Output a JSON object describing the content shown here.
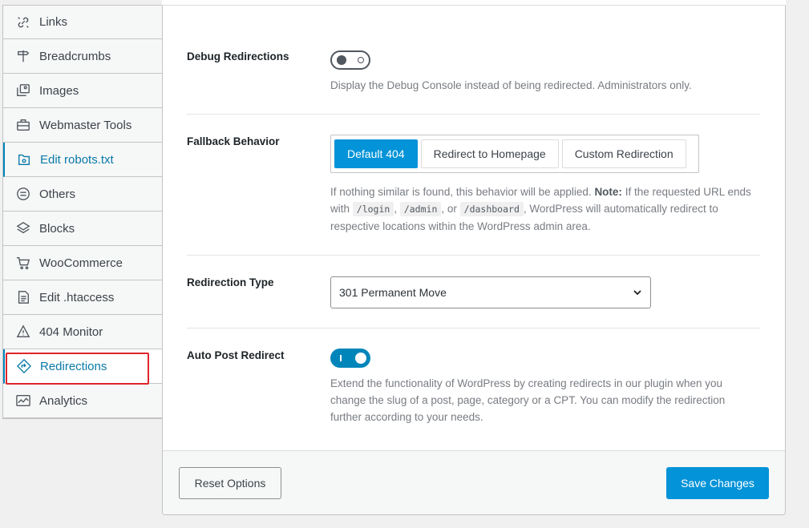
{
  "sidebar": {
    "items": [
      {
        "label": "Links",
        "icon": "links-icon"
      },
      {
        "label": "Breadcrumbs",
        "icon": "signpost-icon"
      },
      {
        "label": "Images",
        "icon": "images-icon"
      },
      {
        "label": "Webmaster Tools",
        "icon": "toolbox-icon"
      },
      {
        "label": "Edit robots.txt",
        "icon": "robots-file-icon"
      },
      {
        "label": "Others",
        "icon": "circle-lines-icon"
      },
      {
        "label": "Blocks",
        "icon": "blocks-icon"
      },
      {
        "label": "WooCommerce",
        "icon": "cart-icon"
      },
      {
        "label": "Edit .htaccess",
        "icon": "file-text-icon"
      },
      {
        "label": "404 Monitor",
        "icon": "warning-icon"
      },
      {
        "label": "Redirections",
        "icon": "redirect-diamond-icon"
      },
      {
        "label": "Analytics",
        "icon": "analytics-icon"
      }
    ],
    "active": "Redirections"
  },
  "debug": {
    "label": "Debug Redirections",
    "enabled": false,
    "description": "Display the Debug Console instead of being redirected. Administrators only."
  },
  "fallback": {
    "label": "Fallback Behavior",
    "options": [
      "Default 404",
      "Redirect to Homepage",
      "Custom Redirection"
    ],
    "selected": "Default 404",
    "desc_part1": "If nothing similar is found, this behavior will be applied. ",
    "desc_note": "Note:",
    "desc_part2": " If the requested URL ends with ",
    "code1": "/login",
    "sep1": ", ",
    "code2": "/admin",
    "sep2": ", or ",
    "code3": "/dashboard",
    "desc_part3": ", WordPress will automatically redirect to respective locations within the WordPress admin area."
  },
  "redirection_type": {
    "label": "Redirection Type",
    "value": "301 Permanent Move"
  },
  "auto_post": {
    "label": "Auto Post Redirect",
    "enabled": true,
    "description": "Extend the functionality of WordPress by creating redirects in our plugin when you change the slug of a post, page, category or a CPT. You can modify the redirection further according to your needs."
  },
  "footer": {
    "reset_label": "Reset Options",
    "save_label": "Save Changes"
  },
  "colors": {
    "accent": "#0393d8",
    "highlight": "#e0242b"
  }
}
